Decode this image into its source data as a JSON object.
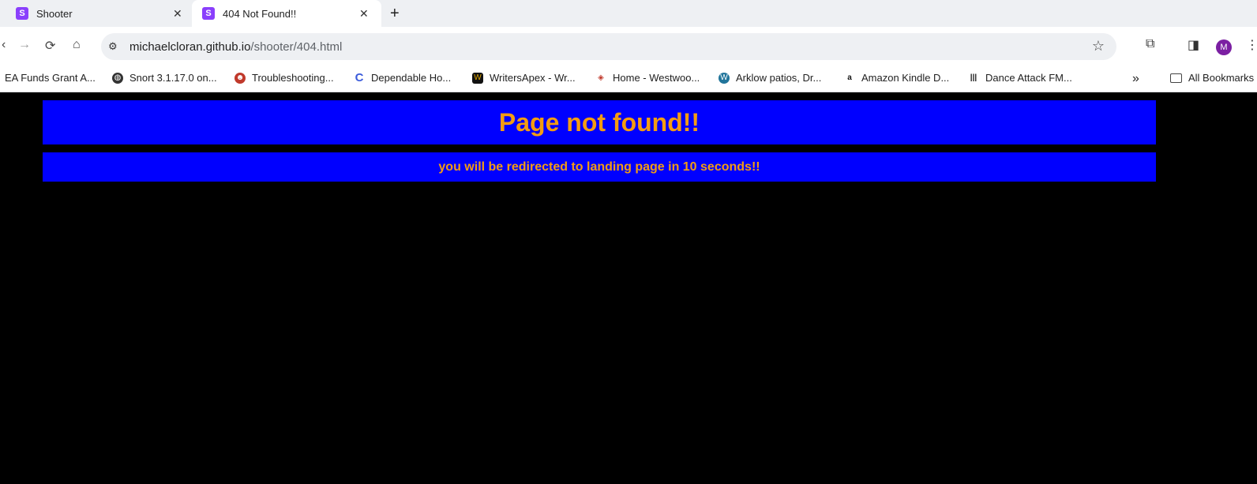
{
  "browser": {
    "tabs": [
      {
        "favicon": "S",
        "title": "Shooter",
        "close": "✕"
      },
      {
        "favicon": "S",
        "title": "404 Not Found!!",
        "close": "✕"
      }
    ],
    "new_tab": "+",
    "url_host": "michaelcloran.github.io",
    "url_path": "/shooter/404.html",
    "avatar_letter": "M",
    "bookmarks": [
      "EA Funds Grant A...",
      "Snort 3.1.17.0 on...",
      "Troubleshooting...",
      "Dependable Ho...",
      "WritersApex - Wr...",
      "Home - Westwoo...",
      "Arklow patios, Dr...",
      "Amazon Kindle D...",
      "Dance Attack FM..."
    ],
    "overflow": "»",
    "all_bookmarks": "All Bookmarks"
  },
  "page": {
    "title": "Page not found!!",
    "subtitle": "you will be redirected to landing page in 10 seconds!!"
  },
  "colors": {
    "banner_bg": "#0000ff",
    "banner_text": "#f39c12",
    "page_bg": "#000000"
  }
}
